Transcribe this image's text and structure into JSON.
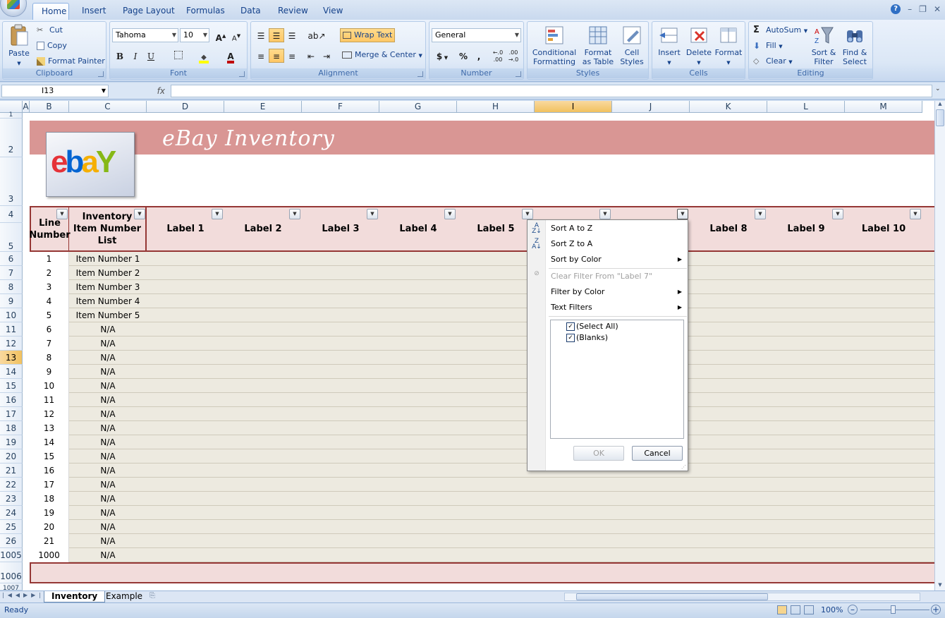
{
  "tabs": [
    "Home",
    "Insert",
    "Page Layout",
    "Formulas",
    "Data",
    "Review",
    "View"
  ],
  "clipboard": {
    "paste": "Paste",
    "cut": "Cut",
    "copy": "Copy",
    "format_painter": "Format Painter",
    "label": "Clipboard"
  },
  "font": {
    "name": "Tahoma",
    "size": "10",
    "bold": "B",
    "italic": "I",
    "underline": "U",
    "grow": "A",
    "shrink": "A",
    "color": "A",
    "label": "Font"
  },
  "alignment": {
    "wrap_text": "Wrap Text",
    "merge_center": "Merge & Center",
    "label": "Alignment"
  },
  "number": {
    "format": "General",
    "currency": "$",
    "percent": "%",
    "comma": ",",
    "inc_decimal": "←.0 .00",
    "dec_decimal": ".00 →.0",
    "label": "Number"
  },
  "styles": {
    "cond_format": "Conditional Formatting",
    "format_table": "Format as Table",
    "cell_styles": "Cell Styles",
    "label": "Styles"
  },
  "cells": {
    "insert": "Insert",
    "delete": "Delete",
    "format": "Format",
    "label": "Cells"
  },
  "editing": {
    "autosum": "AutoSum",
    "fill": "Fill",
    "clear": "Clear",
    "sort_filter": "Sort & Filter",
    "find_select": "Find & Select",
    "label": "Editing"
  },
  "formula_bar": {
    "name_box": "I13",
    "fx": "fx",
    "value": ""
  },
  "columns": [
    "A",
    "B",
    "C",
    "D",
    "E",
    "F",
    "G",
    "H",
    "I",
    "J",
    "K",
    "L",
    "M"
  ],
  "sheet": {
    "title": "eBay Inventory",
    "logo_text": "ebay",
    "header_b": "Line Number",
    "header_c": "Inventory Item Number List",
    "labels": [
      "Label 1",
      "Label 2",
      "Label 3",
      "Label 4",
      "Label 5",
      "Label 8",
      "Label 9",
      "Label 10"
    ],
    "rows": [
      {
        "rownum": "6",
        "line": "1",
        "item": "Item Number 1"
      },
      {
        "rownum": "7",
        "line": "2",
        "item": "Item Number 2"
      },
      {
        "rownum": "8",
        "line": "3",
        "item": "Item Number 3"
      },
      {
        "rownum": "9",
        "line": "4",
        "item": "Item Number 4"
      },
      {
        "rownum": "10",
        "line": "5",
        "item": "Item Number 5"
      },
      {
        "rownum": "11",
        "line": "6",
        "item": "N/A"
      },
      {
        "rownum": "12",
        "line": "7",
        "item": "N/A"
      },
      {
        "rownum": "13",
        "line": "8",
        "item": "N/A"
      },
      {
        "rownum": "14",
        "line": "9",
        "item": "N/A"
      },
      {
        "rownum": "15",
        "line": "10",
        "item": "N/A"
      },
      {
        "rownum": "16",
        "line": "11",
        "item": "N/A"
      },
      {
        "rownum": "17",
        "line": "12",
        "item": "N/A"
      },
      {
        "rownum": "18",
        "line": "13",
        "item": "N/A"
      },
      {
        "rownum": "19",
        "line": "14",
        "item": "N/A"
      },
      {
        "rownum": "20",
        "line": "15",
        "item": "N/A"
      },
      {
        "rownum": "21",
        "line": "16",
        "item": "N/A"
      },
      {
        "rownum": "22",
        "line": "17",
        "item": "N/A"
      },
      {
        "rownum": "23",
        "line": "18",
        "item": "N/A"
      },
      {
        "rownum": "24",
        "line": "19",
        "item": "N/A"
      },
      {
        "rownum": "25",
        "line": "20",
        "item": "N/A"
      },
      {
        "rownum": "26",
        "line": "21",
        "item": "N/A"
      },
      {
        "rownum": "1005",
        "line": "1000",
        "item": "N/A"
      }
    ],
    "extra_rownums": [
      "1",
      "2",
      "3",
      "4",
      "5",
      "1006",
      "1007"
    ]
  },
  "filter_menu": {
    "sort_az": "Sort A to Z",
    "sort_za": "Sort Z to A",
    "sort_color": "Sort by Color",
    "clear_filter": "Clear Filter From \"Label 7\"",
    "filter_color": "Filter by Color",
    "text_filters": "Text Filters",
    "select_all": "(Select All)",
    "blanks": "(Blanks)",
    "ok": "OK",
    "cancel": "Cancel"
  },
  "sheet_tabs": [
    "Inventory",
    "Example"
  ],
  "status": {
    "ready": "Ready",
    "zoom": "100%"
  },
  "colors": {
    "banner": "#d99694",
    "header_fill": "#f2dcdb",
    "border_red": "#953735",
    "row_fill": "#edeae0",
    "ribbon": "#dbe7f6"
  }
}
